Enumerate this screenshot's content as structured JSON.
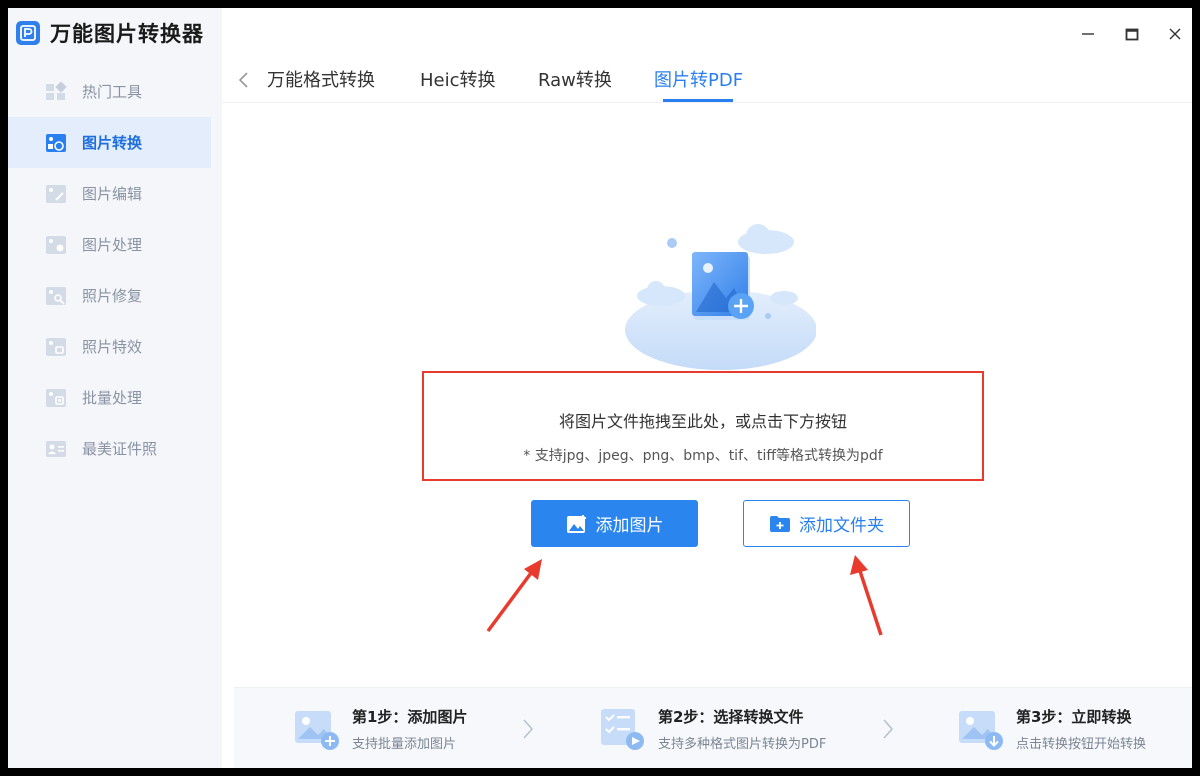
{
  "app": {
    "title": "万能图片转换器",
    "accent_color": "#2a85ee",
    "highlight_color": "#e83a2d"
  },
  "window_controls": {
    "minimize_icon": "minimize-icon",
    "maximize_icon": "maximize-icon",
    "close_icon": "close-icon"
  },
  "sidebar": {
    "items": [
      {
        "label": "热门工具",
        "icon": "hot-tools-icon",
        "active": false
      },
      {
        "label": "图片转换",
        "icon": "image-convert-icon",
        "active": true
      },
      {
        "label": "图片编辑",
        "icon": "image-edit-icon",
        "active": false
      },
      {
        "label": "图片处理",
        "icon": "image-process-icon",
        "active": false
      },
      {
        "label": "照片修复",
        "icon": "photo-repair-icon",
        "active": false
      },
      {
        "label": "照片特效",
        "icon": "photo-effects-icon",
        "active": false
      },
      {
        "label": "批量处理",
        "icon": "batch-process-icon",
        "active": false
      },
      {
        "label": "最美证件照",
        "icon": "id-photo-icon",
        "active": false
      }
    ]
  },
  "tabs": {
    "items": [
      {
        "label": "万能格式转换",
        "active": false
      },
      {
        "label": "Heic转换",
        "active": false
      },
      {
        "label": "Raw转换",
        "active": false
      },
      {
        "label": "图片转PDF",
        "active": true
      }
    ]
  },
  "dropzone": {
    "main_text": "将图片文件拖拽至此处，或点击下方按钮",
    "sub_text": "* 支持jpg、jpeg、png、bmp、tif、tiff等格式转换为pdf"
  },
  "buttons": {
    "add_image": "添加图片",
    "add_folder": "添加文件夹"
  },
  "steps": [
    {
      "title": "第1步：添加图片",
      "desc": "支持批量添加图片"
    },
    {
      "title": "第2步：选择转换文件",
      "desc": "支持多种格式图片转换为PDF"
    },
    {
      "title": "第3步：立即转换",
      "desc": "点击转换按钮开始转换"
    }
  ]
}
